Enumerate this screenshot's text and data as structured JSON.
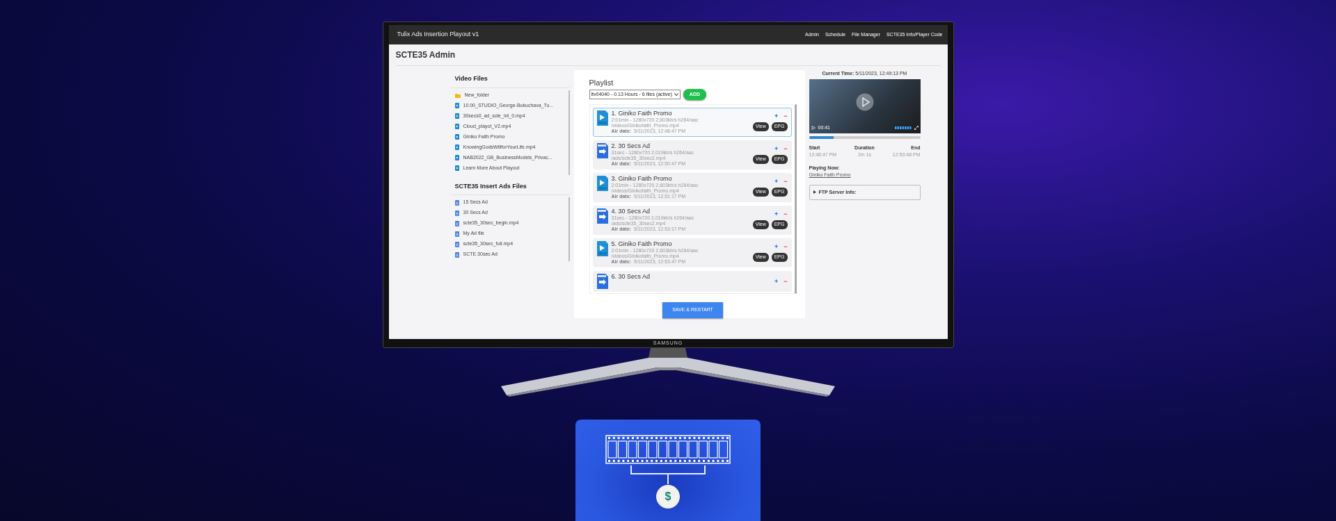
{
  "app": {
    "title": "Tulix Ads Insertion Playout v1",
    "nav": [
      "Admin",
      "Schedule",
      "File Manager",
      "SCTE35 Info/Player Code"
    ],
    "page_title": "SCTE35 Admin"
  },
  "video_files": {
    "heading": "Video Files",
    "items": [
      {
        "kind": "folder",
        "name": "New_folder"
      },
      {
        "kind": "video",
        "name": "10.00_STUDIO_George-Bokuchava_Tu..."
      },
      {
        "kind": "video",
        "name": "30secs0_ad_scte_int_0.mp4"
      },
      {
        "kind": "video",
        "name": "Cloud_playot_V2.mp4"
      },
      {
        "kind": "video",
        "name": "Giniko Faith Promo"
      },
      {
        "kind": "video",
        "name": "KnowingGodsWillforYourLife.mp4"
      },
      {
        "kind": "video",
        "name": "NAB2022_GB_BusinessModels_Privac..."
      },
      {
        "kind": "video",
        "name": "Learn More About Playout"
      }
    ]
  },
  "ad_files": {
    "heading": "SCTE35 Insert Ads Files",
    "items": [
      {
        "kind": "ad",
        "name": "15 Secs Ad"
      },
      {
        "kind": "ad",
        "name": "30 Secs Ad"
      },
      {
        "kind": "ad",
        "name": "scte35_30sec_begin.mp4"
      },
      {
        "kind": "ad",
        "name": "My Ad file"
      },
      {
        "kind": "ad",
        "name": "scte35_30sec_full.mp4"
      },
      {
        "kind": "ad",
        "name": "SCTE 30sec Ad"
      }
    ]
  },
  "playlist": {
    "heading": "Playlist",
    "select": "ltv04040 - 0.13 Hours - 6 files (active)",
    "add_button": "ADD",
    "save_button": "SAVE & RESTART",
    "items": [
      {
        "kind": "promo",
        "selected": true,
        "title": "1. Giniko Faith Promo",
        "details": "2:01min - 1280x720 2,603kb/s h264/aac",
        "path": "/videos/Ginikofaith_Promo.mp4",
        "air_label": "Air date:",
        "air_date": "5/11/2023, 12:48:47 PM",
        "plus": "+",
        "minus": "−",
        "view": "View",
        "epg": "EPG"
      },
      {
        "kind": "scte",
        "selected": false,
        "title": "2. 30 Secs Ad",
        "details": "31sec - 1280x720 2,019kb/s h264/aac",
        "path": "/ads/scte35_30sec2.mp4",
        "air_label": "Air date:",
        "air_date": "5/11/2023, 12:50:47 PM",
        "plus": "+",
        "minus": "−",
        "view": "View",
        "epg": "EPG"
      },
      {
        "kind": "promo",
        "selected": false,
        "title": "3. Giniko Faith Promo",
        "details": "2:01min - 1280x720 2,603kb/s h264/aac",
        "path": "/videos/Ginikofaith_Promo.mp4",
        "air_label": "Air date:",
        "air_date": "5/11/2023, 12:51:17 PM",
        "plus": "+",
        "minus": "−",
        "view": "View",
        "epg": "EPG"
      },
      {
        "kind": "scte",
        "selected": false,
        "title": "4. 30 Secs Ad",
        "details": "31sec - 1280x720 2,019kb/s h264/aac",
        "path": "/ads/scte35_30sec2.mp4",
        "air_label": "Air date:",
        "air_date": "5/11/2023, 12:53:17 PM",
        "plus": "+",
        "minus": "−",
        "view": "View",
        "epg": "EPG"
      },
      {
        "kind": "promo",
        "selected": false,
        "title": "5. Giniko Faith Promo",
        "details": "2:01min - 1280x720 2,603kb/s h264/aac",
        "path": "/videos/Ginikofaith_Promo.mp4",
        "air_label": "Air date:",
        "air_date": "5/11/2023, 12:53:47 PM",
        "plus": "+",
        "minus": "−",
        "view": "View",
        "epg": "EPG"
      },
      {
        "kind": "scte",
        "selected": false,
        "title": "6. 30 Secs Ad",
        "plus": "+",
        "minus": "−"
      }
    ]
  },
  "player": {
    "current_time_label": "Current Time:",
    "current_time": "5/11/2023, 12:49:13 PM",
    "elapsed": "00:41",
    "level": 0.22,
    "start_label": "Start",
    "start": "12:48:47 PM",
    "duration_label": "Duration",
    "duration": "2m 1s",
    "end_label": "End",
    "end": "12:50:48 PM",
    "playing_label": "Playing Now:",
    "playing": "Giniko Faith Promo",
    "ftp": "FTP Server Info:"
  },
  "tv_brand": "SAMSUNG",
  "coin_symbol": "$"
}
